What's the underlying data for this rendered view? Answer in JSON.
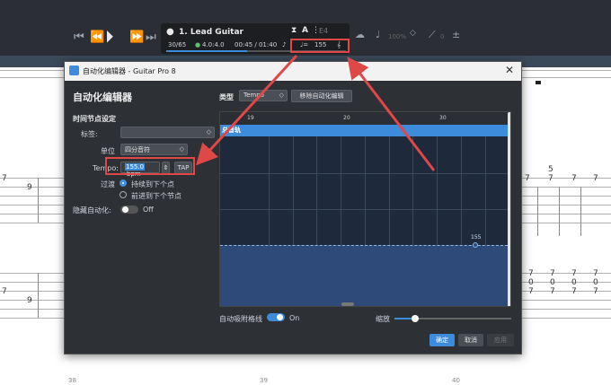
{
  "toolbar": {
    "track_number_title": "1. Lead Guitar",
    "bar_position": "30/65",
    "time_signature": "4.0:4.0",
    "time_elapsed": "00:45 / 01:40",
    "tempo": "155",
    "key": "E4",
    "volume": "100%",
    "pitch_value": "0"
  },
  "score": {
    "tab_numbers": [
      "7",
      "9",
      "7",
      "7",
      "5",
      "7",
      "7",
      "7",
      "7",
      "7",
      "7",
      "7",
      "9",
      "7",
      "7",
      "7",
      "7",
      "0",
      "0",
      "0",
      "0",
      "7",
      "7",
      "7",
      "7"
    ],
    "measure_numbers": [
      "38",
      "39",
      "40"
    ]
  },
  "dialog": {
    "window_title": "自动化编辑器 - Guitar Pro 8",
    "heading": "自动化编辑器",
    "type_label": "类型",
    "type_value": "Tempo",
    "remove_button": "移除自动化编辑",
    "section_label": "时间节点设定",
    "tag_label": "标签:",
    "unit_label": "单位",
    "unit_value": "四分音符",
    "tempo_label": "Tempo:",
    "tempo_value": "155.0",
    "tempo_unit": "bpm",
    "tap_button": "TAP",
    "transition_label": "过渡",
    "transition_option_1": "持续到下个点",
    "transition_option_2": "前进到下个节点",
    "hide_label": "隐藏自动化:",
    "hide_toggle": "Off",
    "ruler_labels": [
      "19",
      "20",
      "30"
    ],
    "track_strip_label": "总音轨",
    "point_value": "155",
    "snap_label": "自动吸附格线",
    "snap_toggle": "On",
    "zoom_label": "缩放",
    "ok_button": "确定",
    "cancel_button": "取消",
    "apply_button": "应用"
  },
  "colors": {
    "accent": "#3d8bdb",
    "callout": "#e04848",
    "dialog_bg": "#2d3035"
  }
}
